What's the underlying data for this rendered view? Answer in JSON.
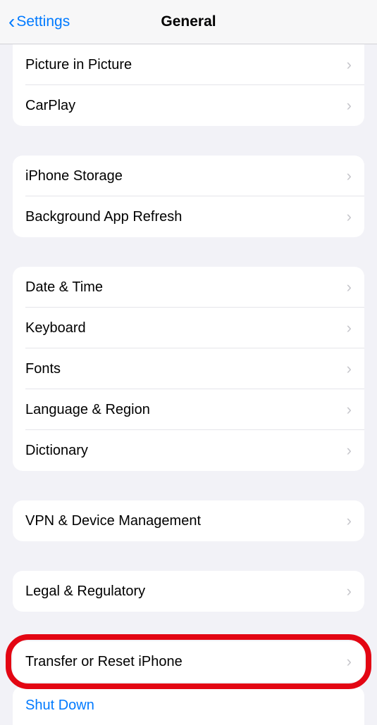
{
  "nav": {
    "back_label": "Settings",
    "title": "General"
  },
  "sections": [
    {
      "rows": [
        "Picture in Picture",
        "CarPlay"
      ]
    },
    {
      "rows": [
        "iPhone Storage",
        "Background App Refresh"
      ]
    },
    {
      "rows": [
        "Date & Time",
        "Keyboard",
        "Fonts",
        "Language & Region",
        "Dictionary"
      ]
    },
    {
      "rows": [
        "VPN & Device Management"
      ]
    },
    {
      "rows": [
        "Legal & Regulatory"
      ]
    },
    {
      "rows": [
        "Transfer or Reset iPhone"
      ]
    }
  ],
  "shutdown_label": "Shut Down"
}
